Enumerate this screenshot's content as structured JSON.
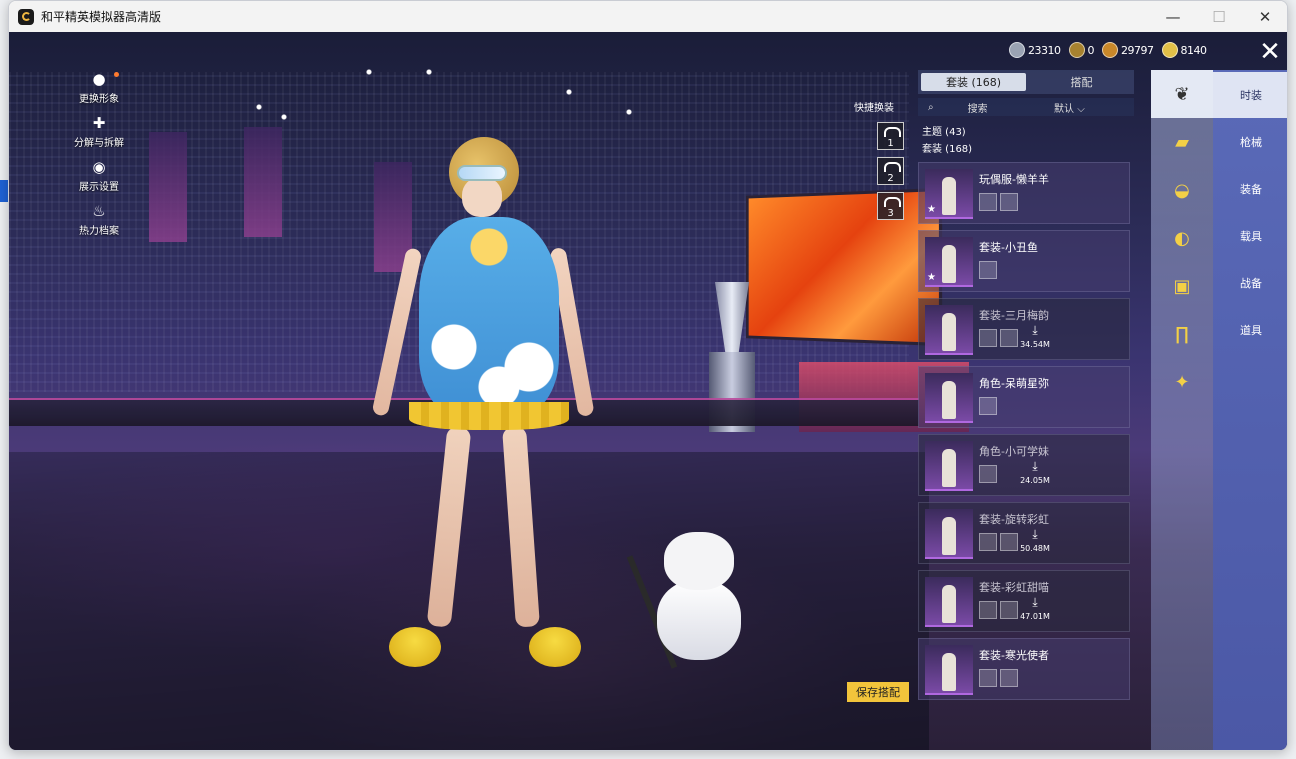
{
  "window": {
    "title": "和平精英模拟器高清版"
  },
  "left_menu": [
    {
      "icon": "person-icon",
      "label": "更换形象"
    },
    {
      "icon": "puzzle-icon",
      "label": "分解与拆解"
    },
    {
      "icon": "eye-icon",
      "label": "展示设置"
    },
    {
      "icon": "flame-icon",
      "label": "热力档案"
    }
  ],
  "currencies": [
    {
      "icon": "silver-coin-icon",
      "value": "23310",
      "color": "#9aa3b3"
    },
    {
      "icon": "bronze-coin-icon",
      "value": "0",
      "color": "#a7822f"
    },
    {
      "icon": "medal-coin-icon",
      "value": "29797",
      "color": "#c9882a"
    },
    {
      "icon": "gold-coin-icon",
      "value": "8140",
      "color": "#e2c048"
    }
  ],
  "close_symbol": "✕",
  "panel": {
    "tabs": [
      {
        "label": "套装 (168)",
        "active": true
      },
      {
        "label": "搭配",
        "active": false
      }
    ],
    "search_placeholder": "搜索",
    "sort_label": "默认",
    "filter_theme": "主题 (43)",
    "filter_set": "套装 (168)",
    "quick_label": "快捷换装",
    "quick_slots": [
      "1",
      "2",
      "3"
    ],
    "items": [
      {
        "name": "玩偶服-懒羊羊",
        "star": true,
        "dim": false,
        "download": "",
        "minis": 2
      },
      {
        "name": "套装-小丑鱼",
        "star": true,
        "dim": false,
        "download": "",
        "minis": 1
      },
      {
        "name": "套装-三月梅韵",
        "star": false,
        "dim": true,
        "download": "34.54M",
        "minis": 2
      },
      {
        "name": "角色-呆萌星弥",
        "star": false,
        "dim": false,
        "download": "",
        "minis": 1
      },
      {
        "name": "角色-小可学妹",
        "star": false,
        "dim": true,
        "download": "24.05M",
        "minis": 1
      },
      {
        "name": "套装-旋转彩虹",
        "star": false,
        "dim": true,
        "download": "50.48M",
        "minis": 2
      },
      {
        "name": "套装-彩虹甜喵",
        "star": false,
        "dim": true,
        "download": "47.01M",
        "minis": 2
      },
      {
        "name": "套装-寒光使者",
        "star": false,
        "dim": false,
        "download": "",
        "minis": 2
      }
    ],
    "save_label": "保存搭配"
  },
  "category_icons": [
    "fashion-icon",
    "gun-skin-icon",
    "helmet-icon",
    "mask-icon",
    "shirt-icon",
    "pants-icon",
    "emote-icon"
  ],
  "nav": [
    {
      "label": "时装",
      "active": true
    },
    {
      "label": "枪械",
      "active": false
    },
    {
      "label": "装备",
      "active": false
    },
    {
      "label": "载具",
      "active": false
    },
    {
      "label": "战备",
      "active": false
    },
    {
      "label": "道具",
      "active": false
    }
  ],
  "colors": {
    "accent": "#f2c43b",
    "nav_bg": "#5a6ab8"
  }
}
